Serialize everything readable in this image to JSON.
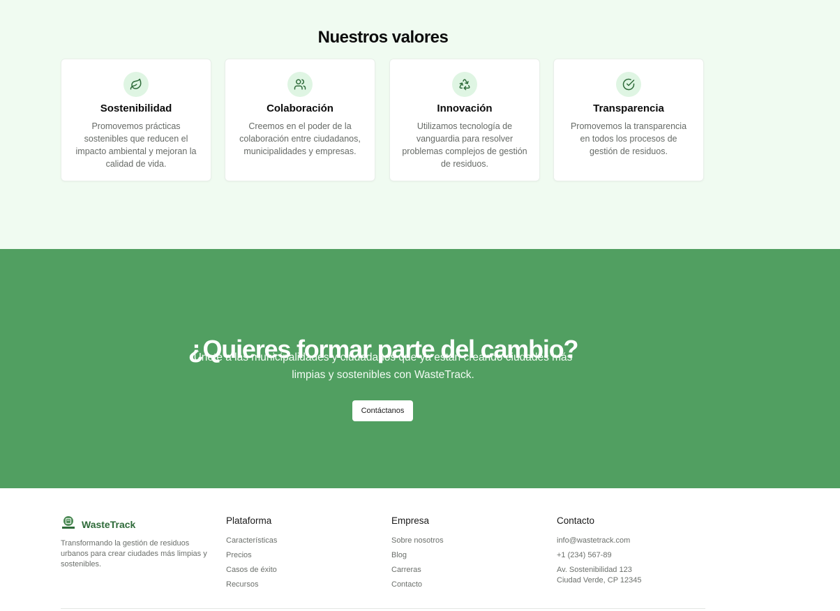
{
  "values_section": {
    "title": "Nuestros valores",
    "cards": [
      {
        "icon": "leaf-icon",
        "title": "Sostenibilidad",
        "text": "Promovemos prácticas sostenibles que reducen el impacto ambiental y mejoran la calidad de vida."
      },
      {
        "icon": "users-icon",
        "title": "Colaboración",
        "text": "Creemos en el poder de la colaboración entre ciudadanos, municipalidades y empresas."
      },
      {
        "icon": "recycle-icon",
        "title": "Innovación",
        "text": "Utilizamos tecnología de vanguardia para resolver problemas complejos de gestión de residuos."
      },
      {
        "icon": "check-circle-icon",
        "title": "Transparencia",
        "text": "Promovemos la transparencia en todos los procesos de gestión de residuos."
      }
    ]
  },
  "cta": {
    "title": "¿Quieres formar parte del cambio?",
    "subtitle": "Únete a las municipalidades y ciudadanos que ya están creando ciudades más limpias y sostenibles con WasteTrack.",
    "button_label": "Contáctanos"
  },
  "footer": {
    "brand_name": "WasteTrack",
    "brand_description": "Transformando la gestión de residuos urbanos para crear ciudades más limpias y sostenibles.",
    "columns": [
      {
        "title": "Plataforma",
        "links": [
          "Características",
          "Precios",
          "Casos de éxito",
          "Recursos"
        ]
      },
      {
        "title": "Empresa",
        "links": [
          "Sobre nosotros",
          "Blog",
          "Carreras",
          "Contacto"
        ]
      },
      {
        "title": "Contacto",
        "email": "info@wastetrack.com",
        "phone": "+1 (234) 567-89",
        "address_line1": "Av. Sostenibilidad 123",
        "address_line2": "Ciudad Verde, CP 12345"
      }
    ]
  },
  "colors": {
    "accent": "#519f61",
    "section_bg": "#f0fbf1",
    "icon_bg": "#dff5e3",
    "brand": "#2f6b3a"
  }
}
